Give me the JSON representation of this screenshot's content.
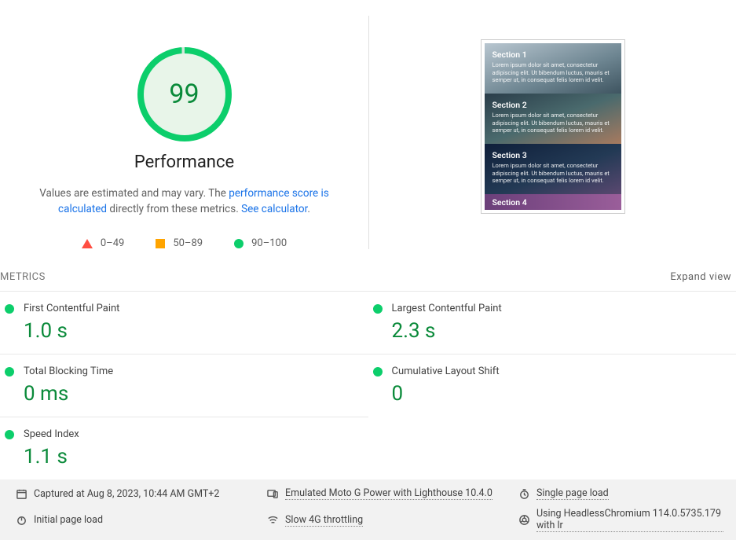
{
  "gauge": {
    "score": "99",
    "title": "Performance"
  },
  "description": {
    "prefix": "Values are estimated and may vary. The ",
    "link1": "performance score is calculated",
    "middle": " directly from these metrics. ",
    "link2": "See calculator"
  },
  "legend": {
    "range1": "0–49",
    "range2": "50–89",
    "range3": "90–100"
  },
  "screenshot": {
    "s1_title": "Section 1",
    "s2_title": "Section 2",
    "s3_title": "Section 3",
    "s4_title": "Section 4",
    "lorem": "Lorem ipsum dolor sit amet, consectetur adipiscing elit. Ut bibendum luctus, mauris et semper ut, in consequat felis lorem id velit."
  },
  "metrics_header": {
    "title": "METRICS",
    "expand": "Expand view"
  },
  "metrics": {
    "fcp": {
      "label": "First Contentful Paint",
      "value": "1.0 s"
    },
    "lcp": {
      "label": "Largest Contentful Paint",
      "value": "2.3 s"
    },
    "tbt": {
      "label": "Total Blocking Time",
      "value": "0 ms"
    },
    "cls": {
      "label": "Cumulative Layout Shift",
      "value": "0"
    },
    "si": {
      "label": "Speed Index",
      "value": "1.1 s"
    }
  },
  "footer": {
    "captured": "Captured at Aug 8, 2023, 10:44 AM GMT+2",
    "emulated": "Emulated Moto G Power with Lighthouse 10.4.0",
    "single": "Single page load",
    "initial": "Initial page load",
    "throttling": "Slow 4G throttling",
    "browser": "Using HeadlessChromium 114.0.5735.179 with lr"
  }
}
